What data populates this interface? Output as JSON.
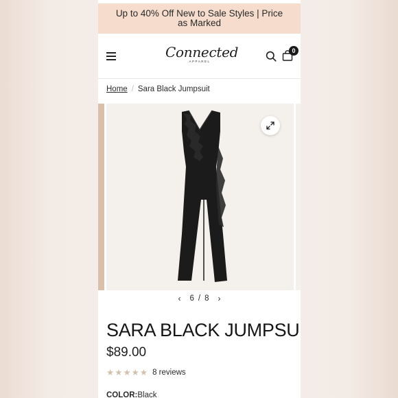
{
  "promo": {
    "text": "Up to 40% Off New to Sale Styles | Price as Marked"
  },
  "header": {
    "logo_text": "Connected",
    "logo_subtext": "APPAREL",
    "cart_count": "0"
  },
  "breadcrumb": {
    "home": "Home",
    "separator": "/",
    "current": "Sara Black Jumpsuit"
  },
  "gallery": {
    "current_index": "6",
    "separator": "/",
    "total": "8",
    "prev_arrow": "‹",
    "next_arrow": "›"
  },
  "product": {
    "title": "SARA BLACK JUMPSUIT",
    "price": "$89.00",
    "rating_stars": 5,
    "reviews": "8 reviews",
    "color_label": "COLOR:",
    "color_value": "Black"
  },
  "colors": {
    "promo_bg": "#f5dccc",
    "star": "#d2c2ad",
    "image_bg": "#f4f0eb"
  }
}
